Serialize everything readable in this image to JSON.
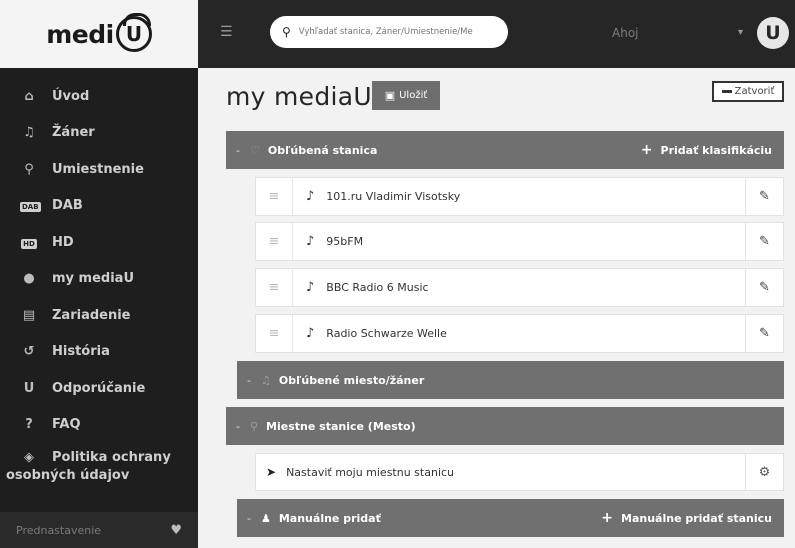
{
  "app": {
    "logo_text": "medi",
    "logo_letter": "U"
  },
  "sidebar": {
    "items": [
      {
        "icon": "home-icon",
        "glyph": "⌂",
        "label": "Úvod"
      },
      {
        "icon": "music-note-icon",
        "glyph": "♫",
        "label": "Žáner"
      },
      {
        "icon": "location-pin-icon",
        "glyph": "⬤",
        "label": "Umiestnenie"
      },
      {
        "icon": "dab-badge-icon",
        "glyph": "DAB",
        "label": "DAB"
      },
      {
        "icon": "hd-badge-icon",
        "glyph": "HD",
        "label": "HD"
      },
      {
        "icon": "mediau-logo-icon",
        "glyph": "ᴜ",
        "label": "my mediaU"
      },
      {
        "icon": "radio-device-icon",
        "glyph": "▤",
        "label": "Zariadenie"
      },
      {
        "icon": "history-icon",
        "glyph": "↺",
        "label": "História"
      },
      {
        "icon": "recommend-icon",
        "glyph": "U",
        "label": "Odporúčanie"
      },
      {
        "icon": "question-icon",
        "glyph": "?",
        "label": "FAQ"
      }
    ],
    "privacy": {
      "icon": "shield-icon",
      "glyph": "◈",
      "line1": "Politika ochrany",
      "line2": "osobných údajov"
    },
    "footer": {
      "label": "Prednastavenie",
      "icon": "heart-icon"
    }
  },
  "topbar": {
    "search_placeholder": "Vyhľadať stanica, Žáner/Umiestnenie/Me",
    "greeting": "Ahoj",
    "avatar_letter": "U"
  },
  "main": {
    "title": "my mediaU",
    "save_label": "Uložiť",
    "close_label": "Zatvoriť",
    "favorite_stations": {
      "header": "Obľúbená stanica",
      "action": "Pridať klasifikáciu",
      "stations": [
        "101.ru Vladimir Visotsky",
        "95bFM",
        "BBC Radio 6 Music",
        "Radio Schwarze Welle"
      ]
    },
    "favorite_places": {
      "header": "Obľúbené miesto/žáner"
    },
    "local_stations": {
      "header": "Miestne stanice  (Mesto)",
      "set_label": "Nastaviť moju miestnu stanicu"
    },
    "manual": {
      "header": "Manuálne pridať",
      "action": "Manuálne pridať stanicu"
    }
  }
}
